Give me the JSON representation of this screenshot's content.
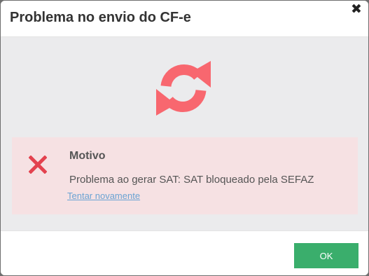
{
  "dialog": {
    "title": "Problema no envio do CF-e",
    "close_label": "✖"
  },
  "status_icon": "sync-icon",
  "alert": {
    "icon": "error-x-icon",
    "title": "Motivo",
    "message": "Problema ao gerar SAT: SAT bloqueado pela SEFAZ",
    "retry_link": "Tentar novamente"
  },
  "footer": {
    "ok_label": "OK"
  },
  "colors": {
    "sync_icon": "#f8676f",
    "error_icon": "#e3424f",
    "alert_background": "#f6e1e3",
    "link": "#6aa3d3",
    "ok_button": "#3aae6c",
    "body_background": "#ebebed"
  }
}
